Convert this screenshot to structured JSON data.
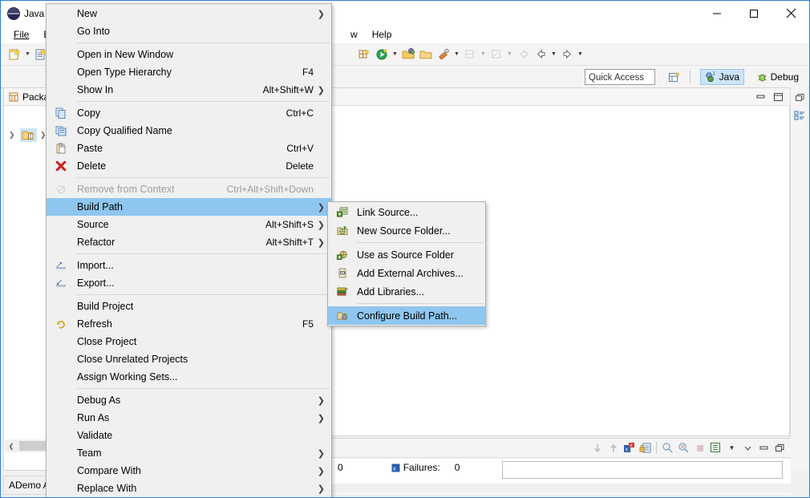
{
  "window": {
    "title": "Java -",
    "app_icon": "eclipse-icon",
    "minimize": "minimize",
    "maximize": "maximize",
    "close": "close"
  },
  "menubar": {
    "items": [
      {
        "label": "File",
        "mnemonic": "F"
      },
      {
        "label": "Edit",
        "mnemonic": "E"
      },
      {
        "label": "w",
        "mnemonic": ""
      },
      {
        "label": "Help",
        "mnemonic": "H"
      }
    ]
  },
  "toolbar": {
    "quick_access_placeholder": "Quick Access",
    "open_perspective": "open-perspective-icon",
    "perspectives": [
      {
        "label": "Java",
        "active": true,
        "icon": "java-perspective-icon"
      },
      {
        "label": "Debug",
        "active": false,
        "icon": "debug-perspective-icon"
      }
    ]
  },
  "package_explorer": {
    "tab_label": "Packag",
    "tree_rows": [
      {
        "label": "",
        "icon": "java-project-icon",
        "expander": ">"
      }
    ],
    "status_label": "ADemo Ap"
  },
  "junit": {
    "failures_label": "Failures:",
    "failures_count": "0",
    "errors_count": "0",
    "toolbar_icons": [
      "next-failure-icon",
      "previous-failure-icon",
      "show-failures-only-icon",
      "lock-scroll-icon",
      "rerun-test-icon",
      "rerun-failed-icon",
      "stop-icon",
      "view-menu-icon",
      "dropdown-icon",
      "minimize-icon",
      "maximize-icon",
      "restore-icon"
    ]
  },
  "context_menu": {
    "name": "project-context-menu",
    "items": [
      {
        "id": "new",
        "label": "New",
        "accel": "",
        "submenu": true,
        "icon": "",
        "disabled": false,
        "selected": false
      },
      {
        "id": "go-into",
        "label": "Go Into",
        "accel": "",
        "submenu": false,
        "icon": "",
        "disabled": false,
        "selected": false
      },
      {
        "id": "sep1",
        "separator": true
      },
      {
        "id": "open-in-new-window",
        "label": "Open in New Window",
        "accel": "",
        "submenu": false,
        "icon": "",
        "disabled": false,
        "selected": false
      },
      {
        "id": "open-type-hierarchy",
        "label": "Open Type Hierarchy",
        "accel": "F4",
        "submenu": false,
        "icon": "",
        "disabled": false,
        "selected": false
      },
      {
        "id": "show-in",
        "label": "Show In",
        "accel": "Alt+Shift+W",
        "submenu": true,
        "icon": "",
        "disabled": false,
        "selected": false
      },
      {
        "id": "sep2",
        "separator": true
      },
      {
        "id": "copy",
        "label": "Copy",
        "accel": "Ctrl+C",
        "submenu": false,
        "icon": "copy-icon",
        "disabled": false,
        "selected": false
      },
      {
        "id": "copy-qualified-name",
        "label": "Copy Qualified Name",
        "accel": "",
        "submenu": false,
        "icon": "copy-qualified-icon",
        "disabled": false,
        "selected": false
      },
      {
        "id": "paste",
        "label": "Paste",
        "accel": "Ctrl+V",
        "submenu": false,
        "icon": "paste-icon",
        "disabled": false,
        "selected": false
      },
      {
        "id": "delete",
        "label": "Delete",
        "accel": "Delete",
        "submenu": false,
        "icon": "delete-icon",
        "disabled": false,
        "selected": false
      },
      {
        "id": "sep3",
        "separator": true
      },
      {
        "id": "remove-from-context",
        "label": "Remove from Context",
        "accel": "Ctrl+Alt+Shift+Down",
        "submenu": false,
        "icon": "remove-context-icon",
        "disabled": true,
        "selected": false
      },
      {
        "id": "build-path",
        "label": "Build Path",
        "accel": "",
        "submenu": true,
        "icon": "",
        "disabled": false,
        "selected": true
      },
      {
        "id": "source",
        "label": "Source",
        "accel": "Alt+Shift+S",
        "submenu": true,
        "icon": "",
        "disabled": false,
        "selected": false
      },
      {
        "id": "refactor",
        "label": "Refactor",
        "accel": "Alt+Shift+T",
        "submenu": true,
        "icon": "",
        "disabled": false,
        "selected": false
      },
      {
        "id": "sep4",
        "separator": true
      },
      {
        "id": "import",
        "label": "Import...",
        "accel": "",
        "submenu": false,
        "icon": "import-icon",
        "disabled": false,
        "selected": false
      },
      {
        "id": "export",
        "label": "Export...",
        "accel": "",
        "submenu": false,
        "icon": "export-icon",
        "disabled": false,
        "selected": false
      },
      {
        "id": "sep5",
        "separator": true
      },
      {
        "id": "build-project",
        "label": "Build Project",
        "accel": "",
        "submenu": false,
        "icon": "",
        "disabled": false,
        "selected": false
      },
      {
        "id": "refresh",
        "label": "Refresh",
        "accel": "F5",
        "submenu": false,
        "icon": "refresh-icon",
        "disabled": false,
        "selected": false
      },
      {
        "id": "close-project",
        "label": "Close Project",
        "accel": "",
        "submenu": false,
        "icon": "",
        "disabled": false,
        "selected": false
      },
      {
        "id": "close-unrelated-projects",
        "label": "Close Unrelated Projects",
        "accel": "",
        "submenu": false,
        "icon": "",
        "disabled": false,
        "selected": false
      },
      {
        "id": "assign-working-sets",
        "label": "Assign Working Sets...",
        "accel": "",
        "submenu": false,
        "icon": "",
        "disabled": false,
        "selected": false
      },
      {
        "id": "sep6",
        "separator": true
      },
      {
        "id": "debug-as",
        "label": "Debug As",
        "accel": "",
        "submenu": true,
        "icon": "",
        "disabled": false,
        "selected": false
      },
      {
        "id": "run-as",
        "label": "Run As",
        "accel": "",
        "submenu": true,
        "icon": "",
        "disabled": false,
        "selected": false
      },
      {
        "id": "validate",
        "label": "Validate",
        "accel": "",
        "submenu": false,
        "icon": "",
        "disabled": false,
        "selected": false
      },
      {
        "id": "team",
        "label": "Team",
        "accel": "",
        "submenu": true,
        "icon": "",
        "disabled": false,
        "selected": false
      },
      {
        "id": "compare-with",
        "label": "Compare With",
        "accel": "",
        "submenu": true,
        "icon": "",
        "disabled": false,
        "selected": false
      },
      {
        "id": "replace-with",
        "label": "Replace With",
        "accel": "",
        "submenu": true,
        "icon": "",
        "disabled": false,
        "selected": false
      }
    ]
  },
  "build_path_submenu": {
    "name": "build-path-submenu",
    "items": [
      {
        "id": "link-source",
        "label": "Link Source...",
        "icon": "link-source-icon",
        "selected": false
      },
      {
        "id": "new-source-folder",
        "label": "New Source Folder...",
        "icon": "new-source-folder-icon",
        "selected": false
      },
      {
        "id": "sep1",
        "separator": true
      },
      {
        "id": "use-as-source-folder",
        "label": "Use as Source Folder",
        "icon": "use-as-source-folder-icon",
        "selected": false
      },
      {
        "id": "add-external-archives",
        "label": "Add External Archives...",
        "icon": "add-external-archives-icon",
        "selected": false
      },
      {
        "id": "add-libraries",
        "label": "Add Libraries...",
        "icon": "add-libraries-icon",
        "selected": false
      },
      {
        "id": "sep2",
        "separator": true
      },
      {
        "id": "configure-build-path",
        "label": "Configure Build Path...",
        "icon": "configure-build-path-icon",
        "selected": true
      }
    ]
  },
  "colors": {
    "menu_bg": "#f0f0f0",
    "menu_highlight": "#8ec6f0",
    "window_border": "#2b7dd4",
    "perspective_active": "#cde4f7"
  }
}
